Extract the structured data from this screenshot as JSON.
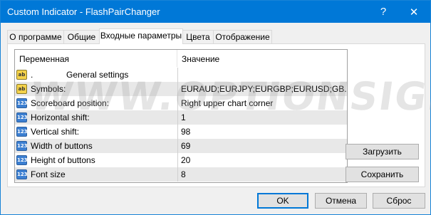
{
  "window": {
    "title": "Custom Indicator - FlashPairChanger",
    "help_glyph": "?",
    "close_glyph": "✕"
  },
  "tabs": [
    {
      "label": "О программе"
    },
    {
      "label": "Общие"
    },
    {
      "label": "Входные параметры"
    },
    {
      "label": "Цвета"
    },
    {
      "label": "Отображение"
    }
  ],
  "active_tab": "Входные параметры",
  "grid": {
    "headers": {
      "variable": "Переменная",
      "value": "Значение"
    },
    "rows": [
      {
        "icon": "ab",
        "name": ".              General settings",
        "value": ""
      },
      {
        "icon": "ab",
        "name": "Symbols:",
        "value": "EURAUD;EURJPY;EURGBP;EURUSD;GB..."
      },
      {
        "icon": "123",
        "name": "Scoreboard position:",
        "value": "Right upper chart corner"
      },
      {
        "icon": "123",
        "name": "Horizontal shift:",
        "value": "1"
      },
      {
        "icon": "123",
        "name": "Vertical shift:",
        "value": "98"
      },
      {
        "icon": "123",
        "name": "Width of buttons",
        "value": "69"
      },
      {
        "icon": "123",
        "name": "Height of buttons",
        "value": "20"
      },
      {
        "icon": "123",
        "name": "Font size",
        "value": "8"
      }
    ]
  },
  "side_buttons": {
    "load": "Загрузить",
    "save": "Сохранить"
  },
  "bottom_buttons": {
    "ok": "OK",
    "cancel": "Отмена",
    "reset": "Сброс"
  },
  "watermark": "WWW.OPTIONSIGNALS.COM",
  "colors": {
    "titlebar": "#0078d7",
    "odd_row": "#e8e8e8",
    "default_button_border": "#0078d7"
  }
}
